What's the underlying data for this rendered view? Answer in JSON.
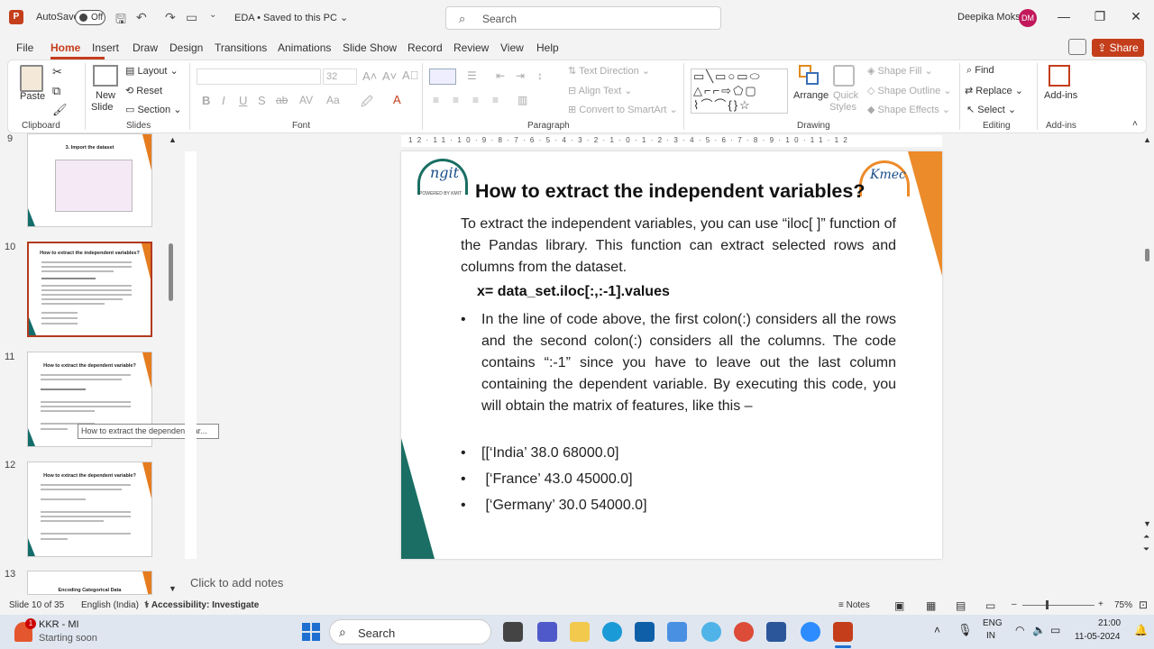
{
  "titlebar": {
    "app_icon": "P",
    "autosave_label": "AutoSave",
    "autosave_state": "Off",
    "doc_title": "EDA • Saved to this PC",
    "search_placeholder": "Search",
    "user_name": "Deepika Moksh",
    "user_initials": "DM"
  },
  "menu": [
    "File",
    "Home",
    "Insert",
    "Draw",
    "Design",
    "Transitions",
    "Animations",
    "Slide Show",
    "Record",
    "Review",
    "View",
    "Help"
  ],
  "share_label": "Share",
  "ribbon": {
    "clipboard": {
      "paste": "Paste",
      "group": "Clipboard"
    },
    "slides": {
      "new_slide_1": "New",
      "new_slide_2": "Slide",
      "layout": "Layout",
      "reset": "Reset",
      "section": "Section",
      "group": "Slides"
    },
    "font": {
      "size": "32",
      "group": "Font"
    },
    "paragraph": {
      "text_direction": "Text Direction",
      "align_text": "Align Text",
      "convert": "Convert to SmartArt",
      "group": "Paragraph"
    },
    "drawing": {
      "arrange": "Arrange",
      "quick_styles_1": "Quick",
      "quick_styles_2": "Styles",
      "shape_fill": "Shape Fill",
      "shape_outline": "Shape Outline",
      "shape_effects": "Shape Effects",
      "group": "Drawing"
    },
    "editing": {
      "find": "Find",
      "replace": "Replace",
      "select": "Select",
      "group": "Editing"
    },
    "addins": {
      "label": "Add-ins",
      "group": "Add-ins"
    }
  },
  "thumbnails": [
    {
      "num": "9",
      "title": "3. Import the dataset"
    },
    {
      "num": "10",
      "title": "How to extract the independent variables?"
    },
    {
      "num": "11",
      "title": "How to extract the dependent variable?"
    },
    {
      "num": "12",
      "title": "How to extract the dependent variable?"
    },
    {
      "num": "13",
      "title": "Encoding Categorical Data"
    }
  ],
  "tooltip": "How to extract the dependent var...",
  "slide": {
    "logo_left": "ngit",
    "logo_left_sub": "POWERED BY KMIT",
    "logo_right": "Kmec",
    "title": "How to extract the independent variables?",
    "intro": "To extract the independent variables, you can use “iloc[ ]” function of the Pandas library. This function can extract selected rows and columns from the dataset.",
    "code": "x= data_set.iloc[:,:-1].values",
    "bullets": [
      "In the line of code above, the first colon(:) considers all the rows and the second colon(:) considers all the columns. The code contains “:-1” since you have to leave out the last column containing the dependent variable. By executing this code, you will obtain the matrix of features, like this –",
      "[[‘India’ 38.0 68000.0]",
      " [‘France’ 43.0 45000.0]",
      " [‘Germany’ 30.0 54000.0]"
    ]
  },
  "notes_placeholder": "Click to add notes",
  "status": {
    "slide_info": "Slide 10 of 35",
    "language": "English (India)",
    "accessibility": "Accessibility: Investigate",
    "notes": "Notes",
    "zoom": "75%"
  },
  "taskbar": {
    "weather_title": "KKR - MI",
    "weather_sub": "Starting soon",
    "badge": "1",
    "search": "Search",
    "lang1": "ENG",
    "lang2": "IN",
    "time": "21:00",
    "date": "11-05-2024"
  },
  "colors": {
    "accent": "#c43e1c",
    "teal": "#1a6e63",
    "orange": "#ec8b2a"
  }
}
